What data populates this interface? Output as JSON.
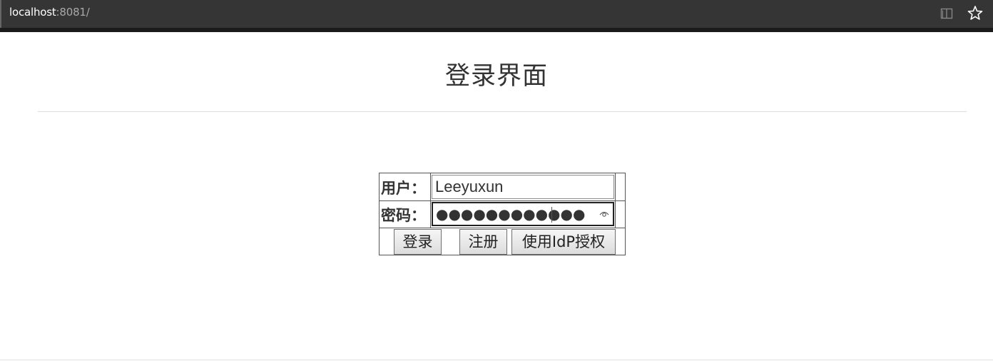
{
  "browser": {
    "url_host": "localhost",
    "url_rest": ":8081/",
    "icons": [
      "reading-view-icon",
      "favorite-star-icon"
    ]
  },
  "page": {
    "title": "登录界面"
  },
  "form": {
    "user_label": "用户：",
    "user_value": "Leeyuxun",
    "password_label": "密码：",
    "password_mask": "●●●●●●●●●●●●",
    "login_button": "登录",
    "register_button": "注册",
    "idp_button": "使用IdP授权"
  }
}
